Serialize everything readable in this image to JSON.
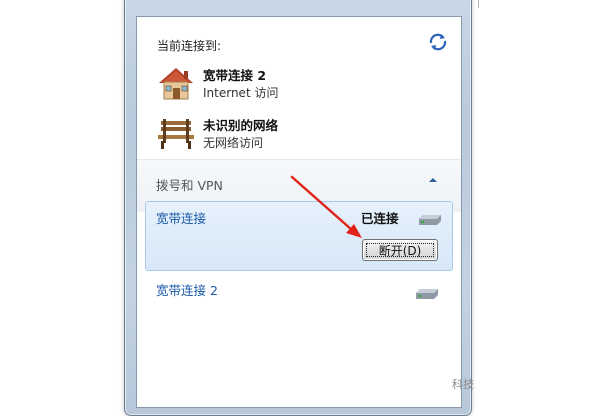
{
  "flyout": {
    "header": "当前连接到:",
    "current_networks": [
      {
        "name": "宽带连接  2",
        "status": "Internet 访问",
        "icon": "house-network-icon"
      },
      {
        "name": "未识别的网络",
        "status": "无网络访问",
        "icon": "park-bench-network-icon"
      }
    ],
    "section": {
      "title": "拨号和 VPN",
      "expanded": true
    },
    "connections": [
      {
        "name": "宽带连接",
        "status": "已连接",
        "button": "断开(D)",
        "selected": true
      },
      {
        "name": "宽带连接 2",
        "status": "",
        "selected": false
      }
    ]
  },
  "annotation": {
    "color": "#e0241b"
  },
  "watermark": "科技"
}
